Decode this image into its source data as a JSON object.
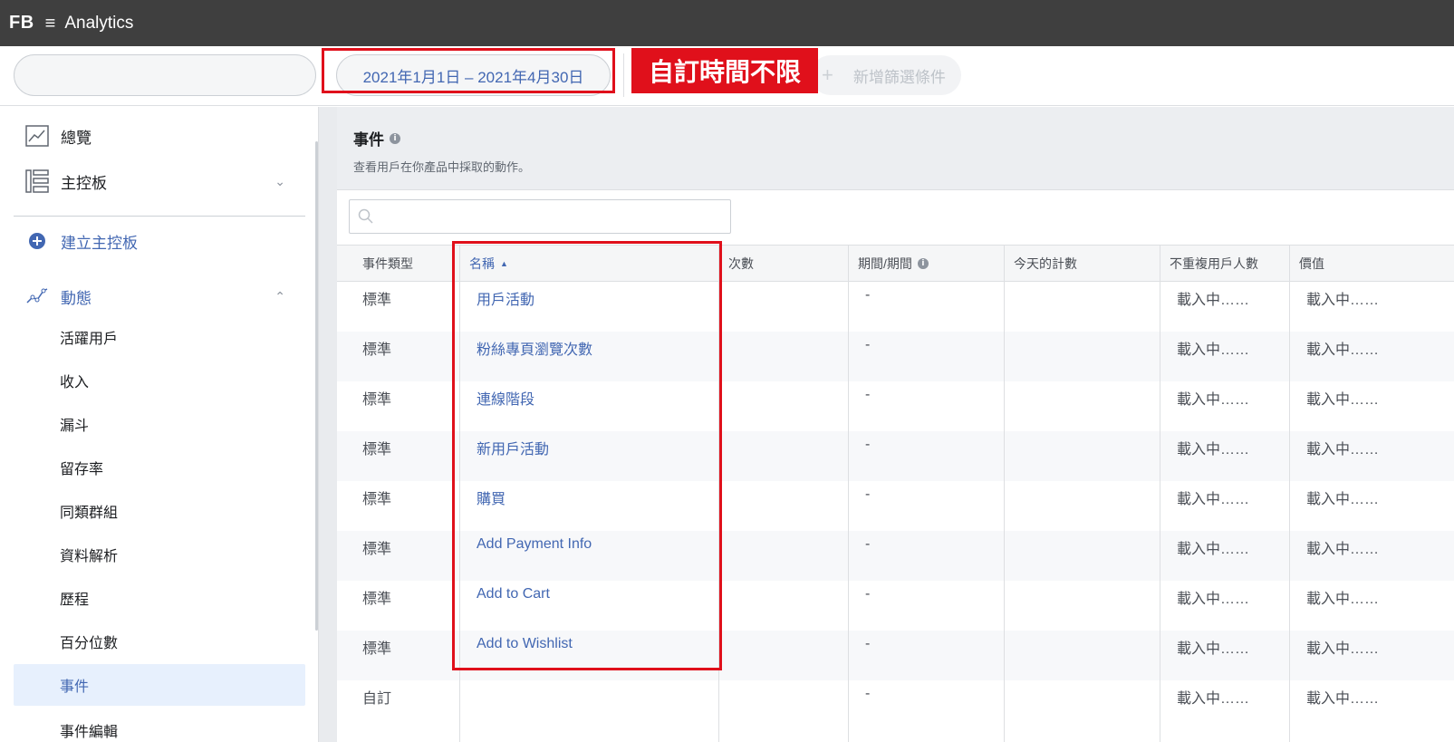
{
  "topbar": {
    "logo": "FB",
    "menu_icon": "≡",
    "title": "Analytics"
  },
  "filters": {
    "date_range": "2021年1月1日 – 2021年4月30日",
    "annotation": "自訂時間不限",
    "add_filter": "新增篩選條件"
  },
  "sidebar": {
    "overview": "總覽",
    "dashboard": "主控板",
    "create_dashboard": "建立主控板",
    "activity": "動態",
    "sub_items": [
      "活躍用戶",
      "收入",
      "漏斗",
      "留存率",
      "同類群組",
      "資料解析",
      "歷程",
      "百分位數",
      "事件",
      "事件編輯"
    ]
  },
  "events": {
    "title": "事件",
    "subtitle": "查看用戶在你產品中採取的動作。",
    "columns": [
      "事件類型",
      "名稱",
      "次數",
      "期間/期間",
      "今天的計數",
      "不重複用戶人數",
      "價值"
    ],
    "rows": [
      {
        "type": "標準",
        "name": "用戶活動",
        "period": "-",
        "users": "載入中……",
        "value": "載入中……"
      },
      {
        "type": "標準",
        "name": "粉絲專頁瀏覽次數",
        "period": "-",
        "users": "載入中……",
        "value": "載入中……"
      },
      {
        "type": "標準",
        "name": "連線階段",
        "period": "-",
        "users": "載入中……",
        "value": "載入中……"
      },
      {
        "type": "標準",
        "name": "新用戶活動",
        "period": "-",
        "users": "載入中……",
        "value": "載入中……"
      },
      {
        "type": "標準",
        "name": "購買",
        "period": "-",
        "users": "載入中……",
        "value": "載入中……"
      },
      {
        "type": "標準",
        "name": "Add Payment Info",
        "period": "-",
        "users": "載入中……",
        "value": "載入中……"
      },
      {
        "type": "標準",
        "name": "Add to Cart",
        "period": "-",
        "users": "載入中……",
        "value": "載入中……"
      },
      {
        "type": "標準",
        "name": "Add to Wishlist",
        "period": "-",
        "users": "載入中……",
        "value": "載入中……"
      },
      {
        "type": "自訂",
        "name": "",
        "period": "-",
        "users": "載入中……",
        "value": "載入中……"
      }
    ]
  },
  "colors": {
    "accent": "#4267b2",
    "highlight": "#e0101b",
    "topbar": "#3f3f3f"
  }
}
